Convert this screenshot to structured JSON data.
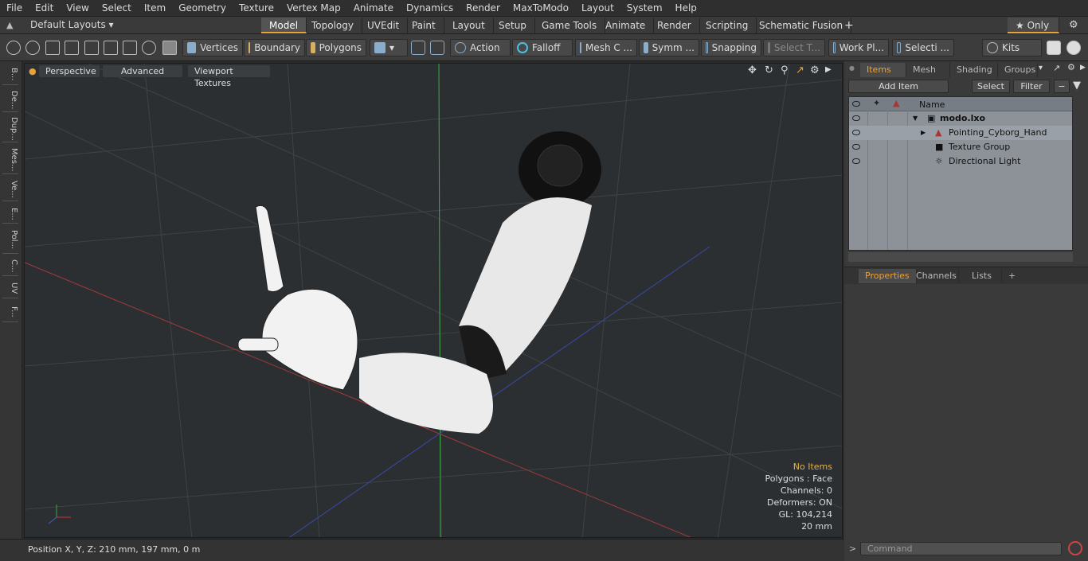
{
  "menu": [
    "File",
    "Edit",
    "View",
    "Select",
    "Item",
    "Geometry",
    "Texture",
    "Vertex Map",
    "Animate",
    "Dynamics",
    "Render",
    "MaxToModo",
    "Layout",
    "System",
    "Help"
  ],
  "layouts": {
    "label": "Default Layouts ▾",
    "only": "★ Only"
  },
  "tabs": [
    "Model",
    "Topology",
    "UVEdit",
    "Paint",
    "Layout",
    "Setup",
    "Game Tools",
    "Animate",
    "Render",
    "Scripting",
    "Schematic Fusion",
    "+"
  ],
  "toolbar": {
    "vertices": "Vertices",
    "boundary": "Boundary",
    "polygons": "Polygons",
    "action": "Action",
    "falloff": "Falloff",
    "mesh": "Mesh C ...",
    "symm": "Symm ...",
    "snapping": "Snapping",
    "select_t": "Select T...",
    "work_pl": "Work Pl...",
    "selecti": "Selecti ...",
    "kits": "Kits"
  },
  "left_tabs": [
    "B...",
    "De...",
    "Dup...",
    "Mes...",
    "Ve...",
    "E...",
    "Pol...",
    "C...",
    "UV",
    "F..."
  ],
  "viewport": {
    "perspective": "Perspective",
    "advanced": "Advanced",
    "textures": "Viewport Textures"
  },
  "info": {
    "no_items": "No Items",
    "polygons": "Polygons : Face",
    "channels": "Channels: 0",
    "deformers": "Deformers: ON",
    "gl": "GL: 104,214",
    "unit": "20 mm"
  },
  "status": "Position X, Y, Z:   210 mm, 197 mm, 0 m",
  "panel": {
    "tabs": [
      "Items",
      "Mesh ...",
      "Shading",
      "Groups"
    ],
    "add_item": "Add Item",
    "select": "Select",
    "filter": "Filter",
    "name_col": "Name",
    "items": [
      "modo.lxo",
      "Pointing_Cyborg_Hand",
      "Texture Group",
      "Directional Light"
    ],
    "prop_tabs": [
      "Properties",
      "Channels",
      "Lists",
      "+"
    ],
    "command": "Command"
  },
  "colors": {
    "accent": "#e8a23a",
    "tree_bg": "#8d9299"
  }
}
